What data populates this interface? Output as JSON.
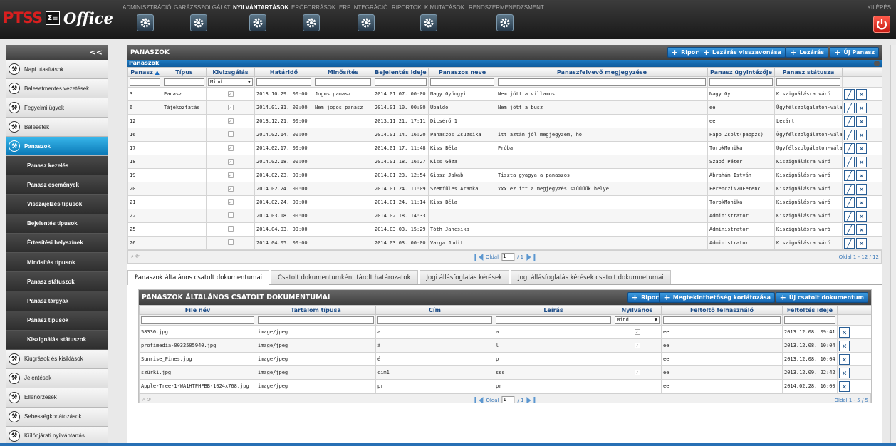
{
  "app": {
    "brand": "PTSS",
    "brand_icon": "Σ≡",
    "office": "Office"
  },
  "topmenu": [
    {
      "label": "ADMINISZTRÁCIÓ",
      "active": false
    },
    {
      "label": "GARÁZSSZOLGÁLAT",
      "active": false
    },
    {
      "label": "NYILVÁNTARTÁSOK",
      "active": true
    },
    {
      "label": "ERŐFORRÁSOK",
      "active": false
    },
    {
      "label": "ERP INTEGRÁCIÓ",
      "active": false
    },
    {
      "label": "RIPORTOK, KIMUTATÁSOK",
      "active": false
    },
    {
      "label": "RENDSZERMENEDZSMENT",
      "active": false
    }
  ],
  "exit_label": "KILÉPÉS",
  "sidebar": {
    "collapse": "<<",
    "items": [
      {
        "label": "Napi utasítások",
        "type": "main"
      },
      {
        "label": "Balesetmentes vezetések",
        "type": "main"
      },
      {
        "label": "Fegyelmi ügyek",
        "type": "main"
      },
      {
        "label": "Balesetek",
        "type": "main"
      },
      {
        "label": "Panaszok",
        "type": "active"
      },
      {
        "label": "Panasz kezelés",
        "type": "sub"
      },
      {
        "label": "Panasz események",
        "type": "sub"
      },
      {
        "label": "Visszajelzés típusok",
        "type": "sub"
      },
      {
        "label": "Bejelentés típusok",
        "type": "sub"
      },
      {
        "label": "Értesítési helyszínek",
        "type": "sub"
      },
      {
        "label": "Minősítés típusok",
        "type": "sub"
      },
      {
        "label": "Panasz státuszok",
        "type": "sub"
      },
      {
        "label": "Panasz tárgyak",
        "type": "sub"
      },
      {
        "label": "Panasz típusok",
        "type": "sub"
      },
      {
        "label": "Kiszignálás státuszok",
        "type": "sub"
      },
      {
        "label": "Kiugrások és kisiklások",
        "type": "main"
      },
      {
        "label": "Jelentések",
        "type": "main"
      },
      {
        "label": "Ellenőrzések",
        "type": "main"
      },
      {
        "label": "Sebességkorlátozások",
        "type": "main"
      },
      {
        "label": "Különjárati nyilvántartás",
        "type": "main"
      }
    ]
  },
  "panel": {
    "title": "PANASZOK",
    "buttons": [
      "Riport",
      "Lezárás visszavonása",
      "Lezárás",
      "Új Panasz"
    ],
    "grid_caption": "Panaszok",
    "columns": [
      "Panasz",
      "Típus",
      "Kivizsgálás",
      "Határidő",
      "Minősítés",
      "Bejelentés ideje",
      "Panaszos neve",
      "Panaszfelvevő megjegyzése",
      "Panasz ügyintézője",
      "Panasz státusza"
    ],
    "sort_icon": "▲",
    "filter_select": "Mind",
    "rows": [
      {
        "id": "3",
        "tipus": "Panasz",
        "kiv": true,
        "hatarido": "2013.10.29. 00:00",
        "min": "Jogos panasz",
        "bej": "2014.01.07. 00:00",
        "nev": "Nagy Gyöngyi",
        "megj": "Nem jött a villamos",
        "ugy": "Nagy Gy",
        "stat": "Kiszignálásra váró"
      },
      {
        "id": "6",
        "tipus": "Tájékoztatás",
        "kiv": true,
        "hatarido": "2014.01.31. 00:00",
        "min": "Nem jogos panasz",
        "bej": "2014.01.10. 00:00",
        "nev": "Ubaldo",
        "megj": "Nem jött a busz",
        "ugy": "ee",
        "stat": "Ügyfélszolgálaton-válasz"
      },
      {
        "id": "12",
        "tipus": "",
        "kiv": true,
        "hatarido": "2013.12.21. 00:00",
        "min": "",
        "bej": "2013.11.21. 17:11",
        "nev": "Dicsérő 1",
        "megj": "",
        "ugy": "ee",
        "stat": "Lezárt"
      },
      {
        "id": "16",
        "tipus": "",
        "kiv": false,
        "hatarido": "2014.02.14. 00:00",
        "min": "",
        "bej": "2014.01.14. 16:20",
        "nev": "Panaszos Zsuzsika",
        "megj": "itt aztán jól megjegyzem, ho",
        "ugy": "Papp Zsolt(pappzs)",
        "stat": "Ügyfélszolgálaton-válasz"
      },
      {
        "id": "17",
        "tipus": "",
        "kiv": true,
        "hatarido": "2014.02.17. 00:00",
        "min": "",
        "bej": "2014.01.17. 11:48",
        "nev": "Kiss Béla",
        "megj": "Próba",
        "ugy": "TorokMonika",
        "stat": "Ügyfélszolgálaton-válasz"
      },
      {
        "id": "18",
        "tipus": "",
        "kiv": true,
        "hatarido": "2014.02.18. 00:00",
        "min": "",
        "bej": "2014.01.18. 16:27",
        "nev": "Kiss Géza",
        "megj": "",
        "ugy": "Szabó Péter",
        "stat": "Kiszignálásra váró"
      },
      {
        "id": "19",
        "tipus": "",
        "kiv": true,
        "hatarido": "2014.02.23. 00:00",
        "min": "",
        "bej": "2014.01.23. 12:54",
        "nev": "Gipsz Jakab",
        "megj": "Tiszta gyagya a panaszos",
        "ugy": "Ábrahám István",
        "stat": "Kiszignálásra váró"
      },
      {
        "id": "20",
        "tipus": "",
        "kiv": true,
        "hatarido": "2014.02.24. 00:00",
        "min": "",
        "bej": "2014.01.24. 11:09",
        "nev": "Szemfüles Aranka",
        "megj": "xxx ez itt a megjegyzés szűűűűk helye",
        "ugy": "Ferenczi%20Ferenc",
        "stat": "Kiszignálásra váró"
      },
      {
        "id": "21",
        "tipus": "",
        "kiv": true,
        "hatarido": "2014.02.24. 00:00",
        "min": "",
        "bej": "2014.01.24. 11:14",
        "nev": "Kiss Béla",
        "megj": "",
        "ugy": "TorokMonika",
        "stat": "Kiszignálásra váró"
      },
      {
        "id": "22",
        "tipus": "",
        "kiv": false,
        "hatarido": "2014.03.18. 00:00",
        "min": "",
        "bej": "2014.02.18. 14:33",
        "nev": "",
        "megj": "",
        "ugy": "Administrator",
        "stat": "Kiszignálásra váró"
      },
      {
        "id": "25",
        "tipus": "",
        "kiv": false,
        "hatarido": "2014.04.03. 00:00",
        "min": "",
        "bej": "2014.03.03. 15:29",
        "nev": "Tóth Jancsika",
        "megj": "",
        "ugy": "Administrator",
        "stat": "Kiszignálásra váró"
      },
      {
        "id": "26",
        "tipus": "",
        "kiv": false,
        "hatarido": "2014.04.05. 00:00",
        "min": "",
        "bej": "2014.03.03. 00:00",
        "nev": "Varga Judit",
        "megj": "",
        "ugy": "Administrator",
        "stat": "Kiszignálásra váró"
      }
    ],
    "pager": {
      "label": "Oldal",
      "page": "1",
      "of": "/ 1",
      "info": "Oldal 1 - 12 / 12"
    }
  },
  "tabs": [
    "Panaszok általános csatolt dokumentumai",
    "Csatolt dokumentumként tárolt határozatok",
    "Jogi állásfoglalás kérések",
    "Jogi állásfoglalás kérések csatolt dokumnetumai"
  ],
  "sub": {
    "title": "PANASZOK ÁLTALÁNOS CSATOLT DOKUMENTUMAI",
    "buttons": [
      "Riport",
      "Megtekinthetőség korlátozása",
      "Új csatolt dokumentum"
    ],
    "columns": [
      "File név",
      "Tartalom típusa",
      "Cím",
      "Leírás",
      "Nyilvános",
      "Feltöltő felhasználó",
      "Feltöltés ideje"
    ],
    "filter_select": "Mind",
    "rows": [
      {
        "file": "58330.jpg",
        "type": "image/jpeg",
        "cim": "a",
        "leiras": "a",
        "pub": true,
        "user": "ee",
        "ido": "2013.12.08. 09:41"
      },
      {
        "file": "profimedia-0032505940.jpg",
        "type": "image/jpeg",
        "cim": "á",
        "leiras": "l",
        "pub": true,
        "user": "ee",
        "ido": "2013.12.08. 10:04"
      },
      {
        "file": "Sunrise_Pines.jpg",
        "type": "image/jpeg",
        "cim": "é",
        "leiras": "p",
        "pub": false,
        "user": "ee",
        "ido": "2013.12.08. 10:04"
      },
      {
        "file": "szürki.jpg",
        "type": "image/jpeg",
        "cim": "cim1",
        "leiras": "sss",
        "pub": true,
        "user": "ee",
        "ido": "2013.12.09. 22:42"
      },
      {
        "file": "Apple-Tree-1-WA1HTPHFBB-1024x768.jpg",
        "type": "image/jpeg",
        "cim": "pr",
        "leiras": "pr",
        "pub": false,
        "user": "ee",
        "ido": "2014.02.28. 16:00"
      }
    ],
    "pager": {
      "label": "Oldal",
      "page": "1",
      "of": "/ 1",
      "info": "Oldal 1 - 5 / 5"
    }
  }
}
